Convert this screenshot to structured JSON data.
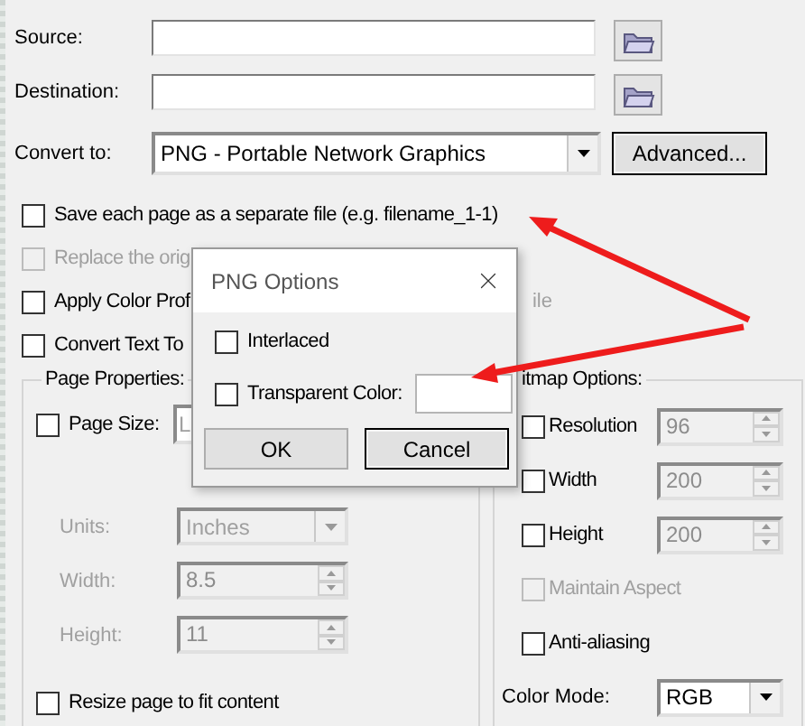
{
  "fields": [
    {
      "label": "Source:"
    },
    {
      "label": "Destination:"
    }
  ],
  "convert": {
    "label": "Convert to:",
    "value": "PNG - Portable Network Graphics",
    "button": "Advanced..."
  },
  "options": [
    {
      "label": "Save each page as a separate file (e.g. filename_1-1)",
      "checked": false,
      "disabled": false
    },
    {
      "label": "Replace the orig",
      "checked": false,
      "disabled": true
    },
    {
      "label": "Apply Color Prof",
      "checked": false,
      "disabled": false,
      "tail": "ile"
    },
    {
      "label": "Convert Text To",
      "checked": false,
      "disabled": false
    }
  ],
  "page_properties": {
    "title": "Page Properties:",
    "page_size": {
      "label": "Page Size:",
      "checked": false,
      "value": "L"
    },
    "units": {
      "label": "Units:",
      "value": "Inches",
      "disabled": true
    },
    "width": {
      "label": "Width:",
      "value": "8.5",
      "disabled": true
    },
    "height": {
      "label": "Height:",
      "value": "11",
      "disabled": true
    },
    "resize": {
      "label": "Resize page to fit content",
      "checked": false
    }
  },
  "bitmap_options": {
    "title": "itmap Options:",
    "items": [
      {
        "kind": "spin",
        "label": "Resolution",
        "checked": false,
        "value": "96",
        "disabled": true
      },
      {
        "kind": "spin",
        "label": "Width",
        "checked": false,
        "value": "200",
        "disabled": true
      },
      {
        "kind": "spin",
        "label": "Height",
        "checked": false,
        "value": "200",
        "disabled": true
      },
      {
        "kind": "check",
        "label": "Maintain Aspect",
        "checked": false,
        "disabled": true
      },
      {
        "kind": "check",
        "label": "Anti-aliasing",
        "checked": false,
        "disabled": false
      },
      {
        "kind": "select",
        "label": "Color Mode:",
        "value": "RGB"
      }
    ]
  },
  "dialog": {
    "title": "PNG Options",
    "options": [
      {
        "label": "Interlaced",
        "checked": false
      },
      {
        "label": "Transparent Color:",
        "checked": false,
        "color": "#ffffff"
      }
    ],
    "buttons": [
      {
        "label": "OK",
        "default": false
      },
      {
        "label": "Cancel",
        "default": true
      }
    ]
  }
}
